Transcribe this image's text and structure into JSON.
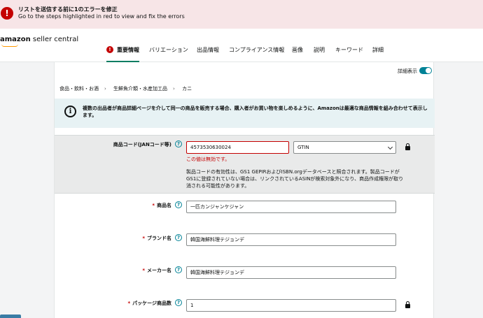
{
  "banner": {
    "title": "リストを送信する前に1のエラーを修正",
    "subtitle": "Go to the steps highlighted in red to view and fix the errors"
  },
  "header": {
    "logo_brand": "amazon",
    "logo_rest": " seller central",
    "tabs": [
      {
        "label": "重要情報",
        "active": true,
        "error": true
      },
      {
        "label": "バリエーション"
      },
      {
        "label": "出品情報"
      },
      {
        "label": "コンプライアンス情報"
      },
      {
        "label": "画像"
      },
      {
        "label": "説明"
      },
      {
        "label": "キーワード"
      },
      {
        "label": "詳細"
      }
    ]
  },
  "toolbar": {
    "detail_label": "詳細表示"
  },
  "breadcrumb": [
    "食品・飲料・お酒",
    "生鮮魚介類・水産加工品",
    "カニ"
  ],
  "info": {
    "icon": "info-icon",
    "text": "複数の出品者が商品詳細ページを介して同一の商品を販売する場合、購入者がお買い物を楽しめるように、Amazonは最適な商品情報を組み合わせて表示します。"
  },
  "product_code": {
    "label": "商品コード(JANコード等)",
    "value": "4573530630024",
    "type_value": "GTIN",
    "error": "この値は無効です。",
    "description": "製品コードの有効性は、GS1 GEPIRおよびISBN.orgデータベースと照合されます。製品コードがGS1に登録されていない場合は、リンクされているASINが検索対象外になり、商品作成権限が取り消される可能性があります。"
  },
  "fields": {
    "product_name": {
      "label": "商品名",
      "value": "一匹カンジャンケジャン"
    },
    "brand_name": {
      "label": "ブランド名",
      "value": "韓国海鮮料理テジョンデ"
    },
    "maker_name": {
      "label": "メーカー名",
      "value": "韓国海鮮料理テジョンデ"
    },
    "package_qty": {
      "label": "パッケージ商品数",
      "value": "1"
    }
  },
  "colors": {
    "error": "#c40000",
    "accent": "#008296",
    "tab_underline": "#067d62",
    "banner_bg": "#f7e5e7",
    "info_bg": "#e7f2f4"
  }
}
